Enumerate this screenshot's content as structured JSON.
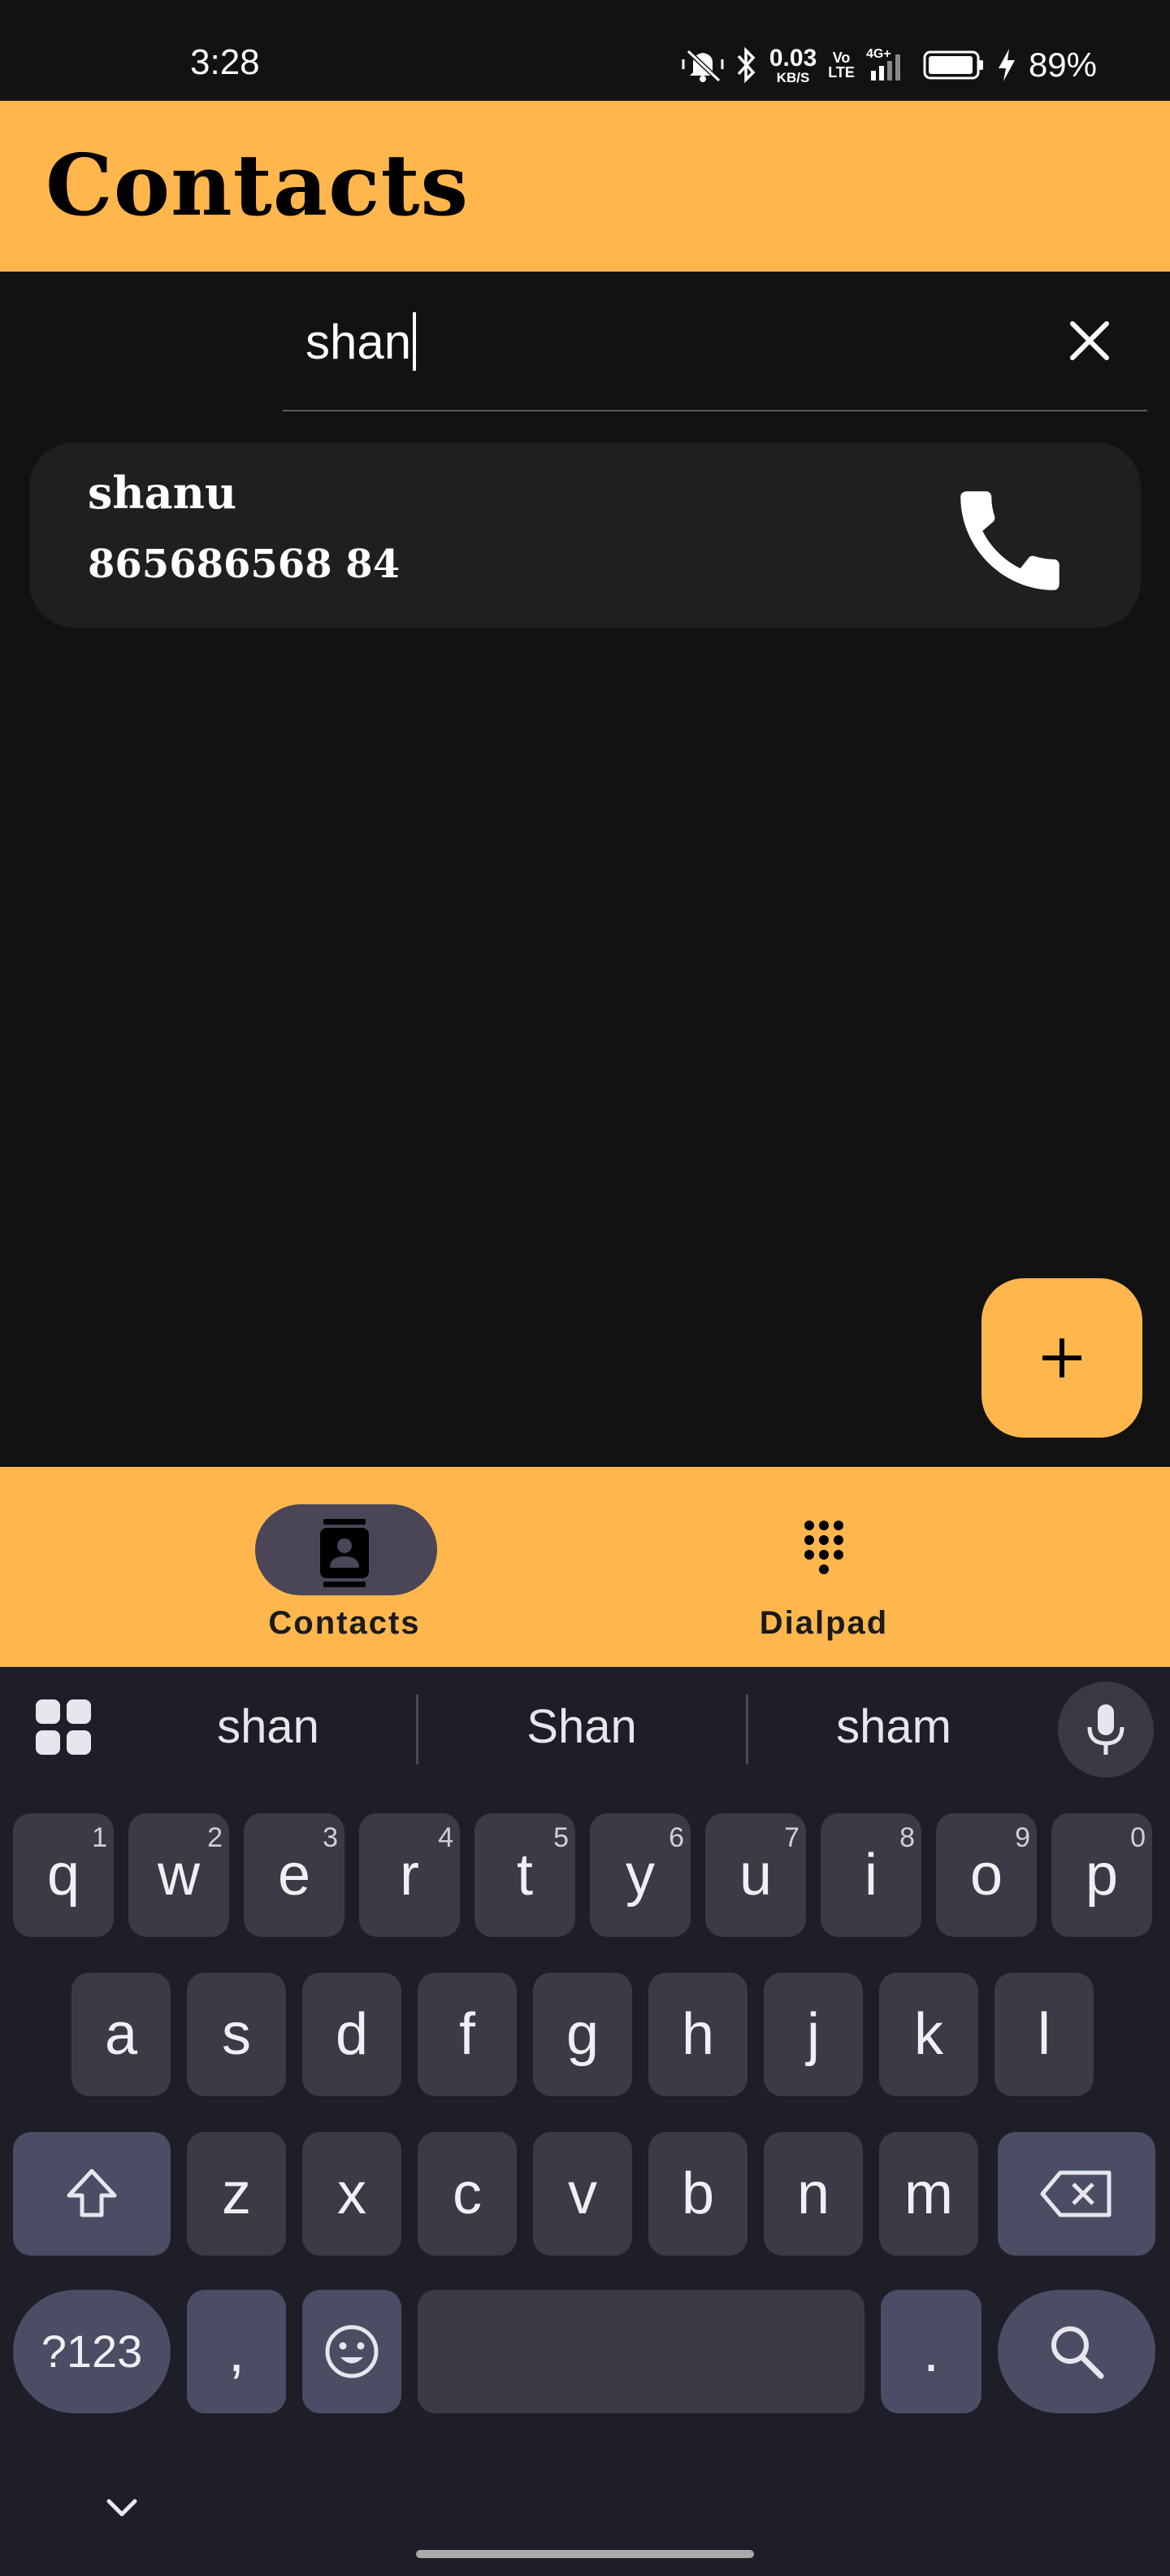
{
  "status_bar": {
    "time": "3:28",
    "net_speed_value": "0.03",
    "net_speed_unit": "KB/S",
    "volte_top": "Vo",
    "volte_bottom": "LTE",
    "network": "4G+",
    "battery_percent": "89%"
  },
  "app_bar": {
    "title": "Contacts"
  },
  "search": {
    "value": "shan",
    "clear_icon": "close-icon"
  },
  "contacts": [
    {
      "name": "shanu",
      "phone": "865686568 84",
      "action_icon": "phone-icon"
    }
  ],
  "fab": {
    "icon": "plus-icon"
  },
  "bottom_nav": {
    "items": [
      {
        "label": "Contacts",
        "icon": "contacts-icon",
        "selected": true
      },
      {
        "label": "Dialpad",
        "icon": "dialpad-icon",
        "selected": false
      }
    ]
  },
  "keyboard": {
    "suggestions": [
      "shan",
      "Shan",
      "sham"
    ],
    "row1": [
      {
        "key": "q",
        "hint": "1"
      },
      {
        "key": "w",
        "hint": "2"
      },
      {
        "key": "e",
        "hint": "3"
      },
      {
        "key": "r",
        "hint": "4"
      },
      {
        "key": "t",
        "hint": "5"
      },
      {
        "key": "y",
        "hint": "6"
      },
      {
        "key": "u",
        "hint": "7"
      },
      {
        "key": "i",
        "hint": "8"
      },
      {
        "key": "o",
        "hint": "9"
      },
      {
        "key": "p",
        "hint": "0"
      }
    ],
    "row2": [
      "a",
      "s",
      "d",
      "f",
      "g",
      "h",
      "j",
      "k",
      "l"
    ],
    "row3": [
      "z",
      "x",
      "c",
      "v",
      "b",
      "n",
      "m"
    ],
    "symbols_label": "?123",
    "comma_label": ",",
    "period_label": "."
  },
  "colors": {
    "accent": "#FFB74D",
    "background": "#121212",
    "card": "#1f1f1f",
    "keyboard": "#1e1e28"
  }
}
